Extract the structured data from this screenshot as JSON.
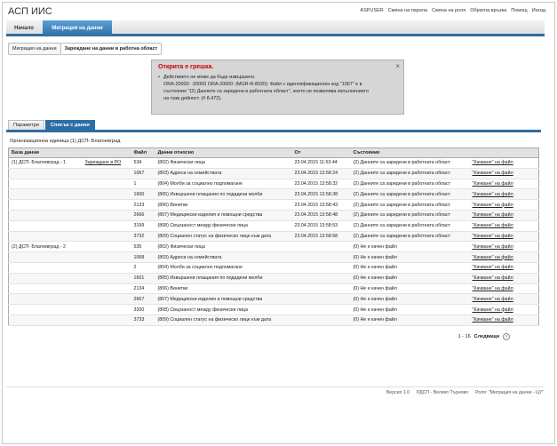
{
  "app_title": "АСП ИИС",
  "top_links": [
    "ASPUSER",
    "Смяна на парола",
    "Смяна на роля",
    "Обратна връзка",
    "Помощ",
    "Изход"
  ],
  "nav": {
    "tabs": [
      "Начало",
      "Миграция на данни"
    ]
  },
  "breadcrumb": [
    "Миграция на данни",
    "Зареждане на данни в работна област"
  ],
  "error": {
    "title": "Открита е грешка.",
    "close": "×",
    "lines": [
      "Действието не може да бъде извършено.",
      "ORA-20000: -20000 ORA-20000: (MGR-R-8020): Файл с идентификационен код \"1067\" е в",
      "състояние \"(2) Данните са заредени в работната област\", което не позволява изпълнението",
      "на тази дейност. (# 8,472)."
    ]
  },
  "page_tabs": [
    "Параметри",
    "Списък с данни"
  ],
  "org_unit": "Организационна единица  (1) ДСП- Благоевград",
  "table": {
    "headers": [
      "База данни",
      "",
      "Файл",
      "Данни относно",
      "От",
      "Състояние",
      ""
    ],
    "rows": [
      [
        "(1) ДСП- Благоевград - 1",
        "Зареждане в РО",
        "534",
        "(802) Физически лица",
        "23.04.2015 11:53:44",
        "(2) Данните са заредени в работната област",
        "\"Качване\" на файл"
      ],
      [
        "",
        "",
        "1067",
        "(803) Адреси на семействата",
        "23.04.2015 13:58:24",
        "(2) Данните са заредени в работната област",
        "\"Качване\" на файл"
      ],
      [
        "",
        "",
        "1",
        "(804) Молби за социално подпомагане",
        "23.04.2015 13:58:32",
        "(2) Данните са заредени в работната област",
        "\"Качване\" на файл"
      ],
      [
        "",
        "",
        "1600",
        "(805) Извършени плащания по подадени молби",
        "23.04.2015 13:58:38",
        "(2) Данните са заредени в работната област",
        "\"Качване\" на файл"
      ],
      [
        "",
        "",
        "2133",
        "(806) Винетки",
        "23.04.2015 13:58:43",
        "(2) Данните са заредени в работната област",
        "\"Качване\" на файл"
      ],
      [
        "",
        "",
        "2666",
        "(807) Медицински изделия и помощни средства",
        "23.04.2015 13:58:48",
        "(2) Данните са заредени в работната област",
        "\"Качване\" на файл"
      ],
      [
        "",
        "",
        "3199",
        "(808) Свързаност между физически лица",
        "23.04.2015 13:58:53",
        "(2) Данните са заредени в работната област",
        "\"Качване\" на файл"
      ],
      [
        "",
        "",
        "3732",
        "(809) Социален статус на физическо лице към дата",
        "23.04.2015 13:58:58",
        "(2) Данните са заредени в работната област",
        "\"Качване\" на файл"
      ],
      [
        "(2) ДСП- Благоевград - 2",
        "",
        "535",
        "(802) Физически лица",
        "",
        "(0) Не е качен файл",
        "\"Качване\" на файл"
      ],
      [
        "",
        "",
        "1068",
        "(803) Адреси на семействата",
        "",
        "(0) Не е качен файл",
        "\"Качване\" на файл"
      ],
      [
        "",
        "",
        "2",
        "(804) Молби за социално подпомагане",
        "",
        "(0) Не е качен файл",
        "\"Качване\" на файл"
      ],
      [
        "",
        "",
        "1601",
        "(805) Извършени плащания по подадени молби",
        "",
        "(0) Не е качен файл",
        "\"Качване\" на файл"
      ],
      [
        "",
        "",
        "2134",
        "(806) Винетки",
        "",
        "(0) Не е качен файл",
        "\"Качване\" на файл"
      ],
      [
        "",
        "",
        "2667",
        "(807) Медицински изделия и помощни средства",
        "",
        "(0) Не е качен файл",
        "\"Качване\" на файл"
      ],
      [
        "",
        "",
        "3200",
        "(808) Свързаност между физически лица",
        "",
        "(0) Не е качен файл",
        "\"Качване\" на файл"
      ],
      [
        "",
        "",
        "3733",
        "(809) Социален статус на физическо лице към дата",
        "",
        "(0) Не е качен файл",
        "\"Качване\" на файл"
      ]
    ]
  },
  "pager": {
    "range": "1 - 16",
    "next": "Следващи"
  },
  "footer": [
    "Версия 1.0",
    "РДСП - Велико Търново",
    "Роля: \"Миграция на данни - ЦУ\""
  ]
}
